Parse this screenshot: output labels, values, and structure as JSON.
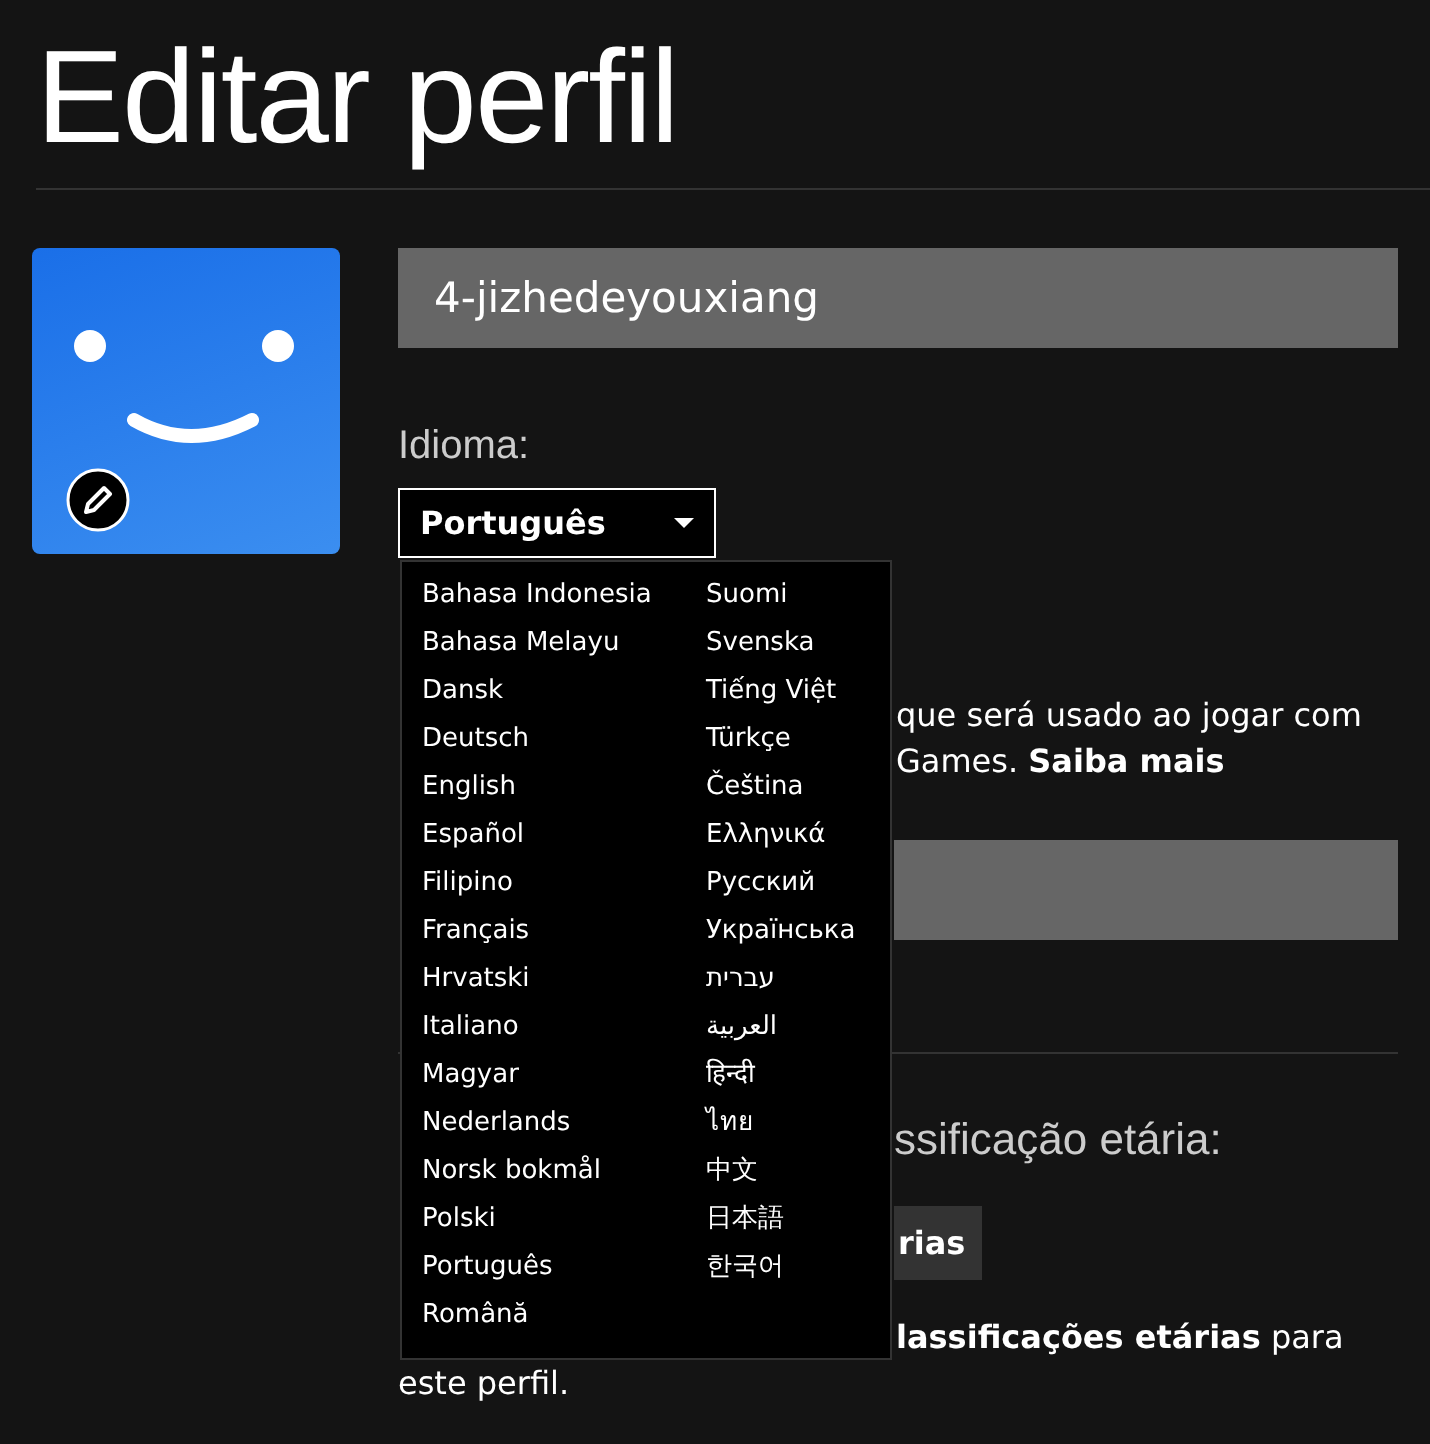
{
  "page_title": "Editar perfil",
  "profile_name": {
    "value": "4-jizhedeyouxiang"
  },
  "language": {
    "label": "Idioma:",
    "value": "Português",
    "options": [
      "Bahasa Indonesia",
      "Bahasa Melayu",
      "Dansk",
      "Deutsch",
      "English",
      "Español",
      "Filipino",
      "Français",
      "Hrvatski",
      "Italiano",
      "Magyar",
      "Nederlands",
      "Norsk bokmål",
      "Polski",
      "Português",
      "Română",
      "Suomi",
      "Svenska",
      "Tiếng Việt",
      "Türkçe",
      "Čeština",
      "Ελληνικά",
      "Русский",
      "Українська",
      "עברית",
      "العربية",
      "हिन्दी",
      "ไทย",
      "中文",
      "日本語",
      "한국어"
    ]
  },
  "game_id": {
    "description_lines": [
      "que será usado ao jogar com",
      "Games."
    ],
    "link": "Saiba mais"
  },
  "maturity": {
    "label": "ssificação etária:",
    "button": "rias",
    "description_lines": [
      "**lassificações etárias** para",
      "este perfil."
    ]
  }
}
